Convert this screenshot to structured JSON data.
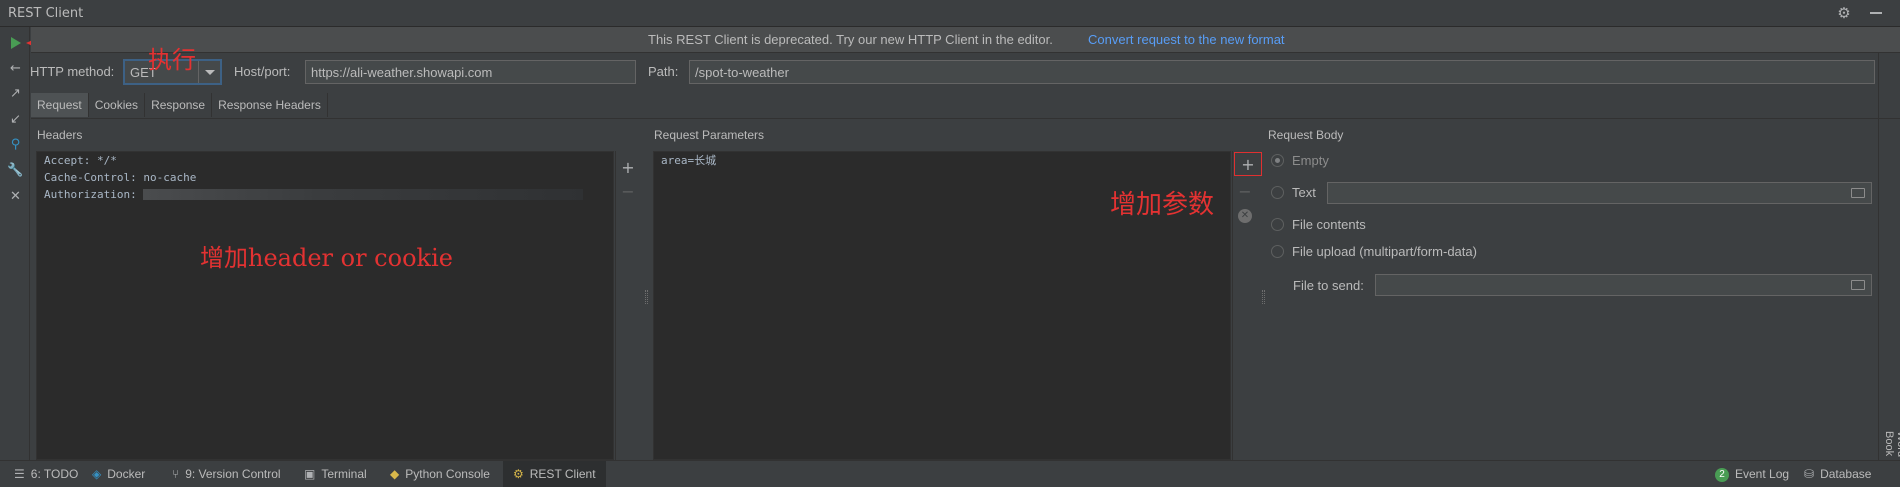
{
  "window": {
    "title": "REST Client"
  },
  "banner": {
    "message": "This REST Client is deprecated. Try our new HTTP Client in the editor.",
    "link": "Convert request to the new format"
  },
  "request": {
    "method_label": "HTTP method:",
    "method_value": "GET",
    "host_label": "Host/port:",
    "host_value": "https://ali-weather.showapi.com",
    "path_label": "Path:",
    "path_value": "/spot-to-weather"
  },
  "tabs": [
    "Request",
    "Cookies",
    "Response",
    "Response Headers"
  ],
  "headers": {
    "title": "Headers",
    "lines": [
      "Accept: */*",
      "Cache-Control: no-cache",
      "Authorization:"
    ]
  },
  "params": {
    "title": "Request Parameters",
    "lines": [
      "area=长城"
    ]
  },
  "body": {
    "title": "Request Body",
    "options": [
      "Empty",
      "Text",
      "File contents",
      "File upload (multipart/form-data)"
    ],
    "file_label": "File to send:"
  },
  "annotations": {
    "execute": "执行",
    "add_header": "增加header or cookie",
    "add_param": "增加参数"
  },
  "statusbar": {
    "todo": "6: TODO",
    "docker": "Docker",
    "vcs": "9: Version Control",
    "terminal": "Terminal",
    "python": "Python Console",
    "rest": "REST Client",
    "event_count": "2",
    "event_log": "Event Log",
    "database": "Database"
  },
  "right_strip": {
    "label": "Word Book"
  },
  "colors": {
    "accent": "#589df6",
    "run": "#499c54",
    "annotation": "#e33232"
  }
}
